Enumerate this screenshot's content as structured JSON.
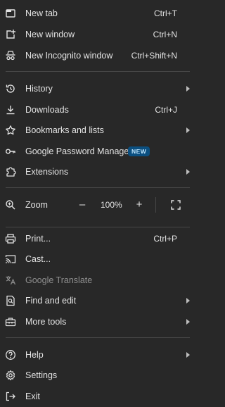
{
  "menu": {
    "new_tab": {
      "label": "New tab",
      "shortcut": "Ctrl+T"
    },
    "new_window": {
      "label": "New window",
      "shortcut": "Ctrl+N"
    },
    "new_incognito": {
      "label": "New Incognito window",
      "shortcut": "Ctrl+Shift+N"
    },
    "history": {
      "label": "History"
    },
    "downloads": {
      "label": "Downloads",
      "shortcut": "Ctrl+J"
    },
    "bookmarks": {
      "label": "Bookmarks and lists"
    },
    "password_manager": {
      "label": "Google Password Manager",
      "badge": "NEW"
    },
    "extensions": {
      "label": "Extensions"
    },
    "zoom": {
      "label": "Zoom",
      "minus": "–",
      "value": "100%",
      "plus": "+"
    },
    "print": {
      "label": "Print...",
      "shortcut": "Ctrl+P"
    },
    "cast": {
      "label": "Cast..."
    },
    "translate": {
      "label": "Google Translate",
      "disabled": true
    },
    "find_edit": {
      "label": "Find and edit"
    },
    "more_tools": {
      "label": "More tools"
    },
    "help": {
      "label": "Help"
    },
    "settings": {
      "label": "Settings"
    },
    "exit": {
      "label": "Exit"
    }
  },
  "colors": {
    "background": "#282828",
    "text": "#e3e3e3",
    "disabled_text": "#8e8e8e",
    "separator": "#474747",
    "badge_bg": "#0b4f80",
    "badge_text": "#c2e7ff"
  }
}
